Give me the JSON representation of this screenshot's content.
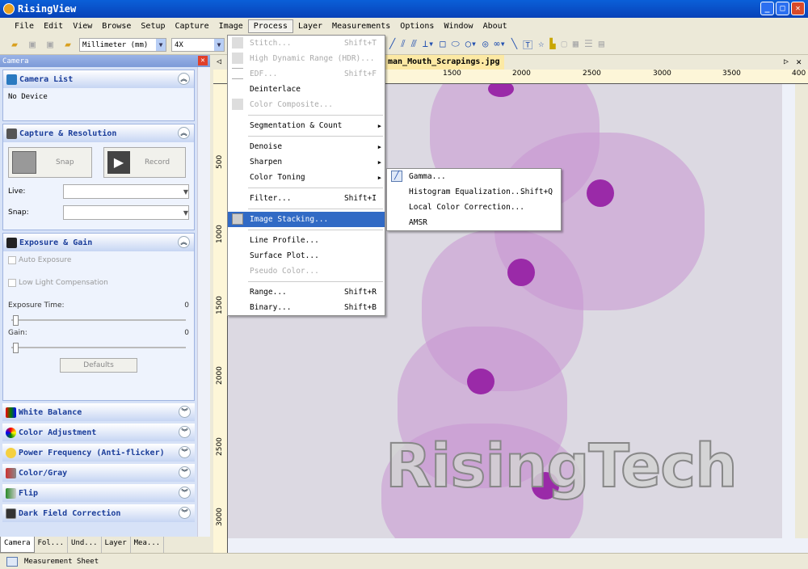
{
  "window": {
    "title": "RisingView"
  },
  "menubar": [
    "File",
    "Edit",
    "View",
    "Browse",
    "Setup",
    "Capture",
    "Image",
    "Process",
    "Layer",
    "Measurements",
    "Options",
    "Window",
    "About"
  ],
  "toolbar": {
    "unit": "Millimeter (mm)",
    "magnification": "4X",
    "partial": "20"
  },
  "camera_panel": {
    "title": "Camera",
    "camera_list": {
      "title": "Camera List",
      "status": "No Device"
    },
    "capture": {
      "title": "Capture & Resolution",
      "snap": "Snap",
      "record": "Record",
      "live_label": "Live:",
      "snap_label": "Snap:"
    },
    "exposure": {
      "title": "Exposure & Gain",
      "auto": "Auto Exposure",
      "low_light": "Low Light Compensation",
      "time_label": "Exposure Time:",
      "time_value": "0",
      "gain_label": "Gain:",
      "gain_value": "0",
      "defaults": "Defaults"
    },
    "sections": [
      "White Balance",
      "Color Adjustment",
      "Power Frequency (Anti-flicker)",
      "Color/Gray",
      "Flip",
      "Dark Field Correction"
    ]
  },
  "bottom_tabs": [
    "Camera",
    "Fol...",
    "Und...",
    "Layer",
    "Mea..."
  ],
  "status": {
    "measurement_sheet": "Measurement Sheet"
  },
  "document": {
    "tab": "man_Mouth_Scrapings.jpg",
    "hruler": [
      "1500",
      "2000",
      "2500",
      "3000",
      "3500",
      "400"
    ],
    "vruler": [
      "500",
      "1000",
      "1500",
      "2000",
      "2500",
      "3000"
    ],
    "watermark": "RisingTech"
  },
  "process_menu": [
    {
      "label": "Stitch...",
      "shortcut": "Shift+T",
      "disabled": true
    },
    {
      "label": "High Dynamic Range (HDR)...",
      "disabled": true
    },
    {
      "label": "EDF...",
      "shortcut": "Shift+F",
      "disabled": true
    },
    {
      "label": "Deinterlace"
    },
    {
      "label": "Color Composite...",
      "disabled": true
    },
    {
      "label": "Segmentation & Count",
      "submenu": true
    },
    {
      "label": "Denoise",
      "submenu": true
    },
    {
      "label": "Sharpen",
      "submenu": true
    },
    {
      "label": "Color Toning",
      "submenu": true
    },
    {
      "label": "Filter...",
      "shortcut": "Shift+I"
    },
    {
      "label": "Image Stacking...",
      "highlighted": true
    },
    {
      "label": "Line Profile..."
    },
    {
      "label": "Surface Plot..."
    },
    {
      "label": "Pseudo Color...",
      "disabled": true
    },
    {
      "label": "Range...",
      "shortcut": "Shift+R"
    },
    {
      "label": "Binary...",
      "shortcut": "Shift+B"
    }
  ],
  "color_toning_submenu": [
    {
      "label": "Gamma..."
    },
    {
      "label": "Histogram Equalization...",
      "shortcut": "Shift+Q"
    },
    {
      "label": "Local Color Correction..."
    },
    {
      "label": "AMSR"
    }
  ],
  "colors": {
    "titlebar": "#0a5fd8",
    "highlight": "#316ac5",
    "section_title": "#1a3d9a",
    "nucleus": "#9a2aa8"
  }
}
